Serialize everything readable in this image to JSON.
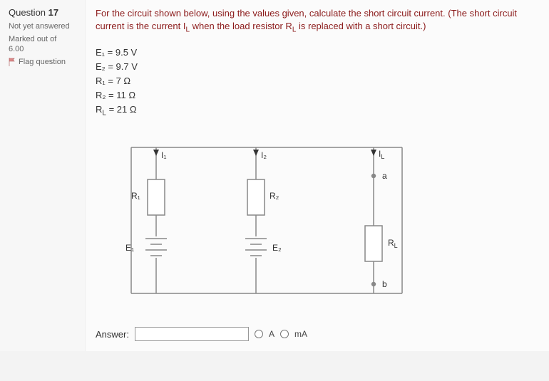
{
  "sidebar": {
    "question_prefix": "Question ",
    "question_number": "17",
    "status": "Not yet answered",
    "marked_line1": "Marked out of",
    "marked_line2": "6.00",
    "flag_label": "Flag question"
  },
  "question": {
    "text": "For the circuit shown below, using the values given, calculate the short circuit current. (The short circuit current is the current I",
    "text_sub": "L",
    "text_mid": " when the load resistor R",
    "text_sub2": "L",
    "text_end": " is replaced with a short circuit.)"
  },
  "values": {
    "e1": "E₁ = 9.5 V",
    "e2": "E₂ = 9.7 V",
    "r1": "R₁ = 7 Ω",
    "r2": "R₂ = 11 Ω",
    "rl": "R",
    "rl_sub": "L",
    "rl_end": " = 21 Ω"
  },
  "diagram": {
    "labels": {
      "I1": "I₁",
      "I2": "I₂",
      "IL": "I",
      "IL_sub": "L",
      "R1": "R₁",
      "R2": "R₂",
      "RL": "R",
      "RL_sub": "L",
      "E1": "E₁",
      "E2": "E₂",
      "a": "a",
      "b": "b"
    }
  },
  "answer": {
    "label": "Answer:",
    "value": "",
    "unit_a": "A",
    "unit_mA": "mA"
  }
}
